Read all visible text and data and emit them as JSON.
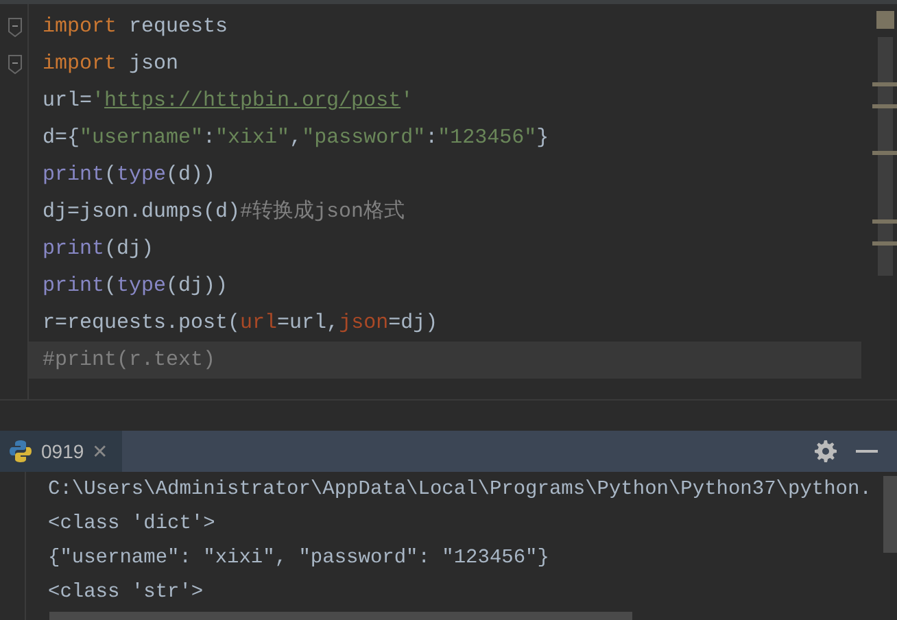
{
  "editor": {
    "lines": [
      {
        "fold": true,
        "current": false,
        "tokens": [
          {
            "kind": "keyword",
            "text": "import"
          },
          {
            "kind": "plain",
            "text": " requests"
          }
        ]
      },
      {
        "fold": true,
        "current": false,
        "tokens": [
          {
            "kind": "keyword",
            "text": "import"
          },
          {
            "kind": "plain",
            "text": " json"
          }
        ]
      },
      {
        "fold": false,
        "current": false,
        "tokens": [
          {
            "kind": "plain",
            "text": "url="
          },
          {
            "kind": "string",
            "text": "'"
          },
          {
            "kind": "link",
            "text": "https://httpbin.org/post"
          },
          {
            "kind": "string",
            "text": "'"
          }
        ]
      },
      {
        "fold": false,
        "current": false,
        "tokens": [
          {
            "kind": "plain",
            "text": "d={"
          },
          {
            "kind": "string",
            "text": "\"username\""
          },
          {
            "kind": "plain",
            "text": ":"
          },
          {
            "kind": "string",
            "text": "\"xixi\""
          },
          {
            "kind": "plain",
            "text": ","
          },
          {
            "kind": "string",
            "text": "\"password\""
          },
          {
            "kind": "plain",
            "text": ":"
          },
          {
            "kind": "string",
            "text": "\"123456\""
          },
          {
            "kind": "plain",
            "text": "}"
          }
        ]
      },
      {
        "fold": false,
        "current": false,
        "tokens": [
          {
            "kind": "builtin",
            "text": "print"
          },
          {
            "kind": "plain",
            "text": "("
          },
          {
            "kind": "builtin",
            "text": "type"
          },
          {
            "kind": "plain",
            "text": "(d))"
          }
        ]
      },
      {
        "fold": false,
        "current": false,
        "tokens": [
          {
            "kind": "plain",
            "text": "dj=json.dumps(d)"
          },
          {
            "kind": "comment",
            "text": "#转换成json格式"
          }
        ]
      },
      {
        "fold": false,
        "current": false,
        "tokens": [
          {
            "kind": "builtin",
            "text": "print"
          },
          {
            "kind": "plain",
            "text": "(dj)"
          }
        ]
      },
      {
        "fold": false,
        "current": false,
        "tokens": [
          {
            "kind": "builtin",
            "text": "print"
          },
          {
            "kind": "plain",
            "text": "("
          },
          {
            "kind": "builtin",
            "text": "type"
          },
          {
            "kind": "plain",
            "text": "(dj))"
          }
        ]
      },
      {
        "fold": false,
        "current": false,
        "tokens": [
          {
            "kind": "plain",
            "text": "r=requests.post("
          },
          {
            "kind": "param",
            "text": "url"
          },
          {
            "kind": "plain",
            "text": "=url,"
          },
          {
            "kind": "param",
            "text": "json"
          },
          {
            "kind": "plain",
            "text": "=dj)"
          }
        ]
      },
      {
        "fold": false,
        "current": true,
        "tokens": [
          {
            "kind": "comment",
            "text": "#print(r.text)"
          }
        ]
      }
    ]
  },
  "run_panel": {
    "tabs": [
      {
        "label": "0919",
        "close": "✕",
        "selected": true
      }
    ],
    "output": [
      "C:\\Users\\Administrator\\AppData\\Local\\Programs\\Python\\Python37\\python.",
      "<class 'dict'>",
      "{\"username\": \"xixi\", \"password\": \"123456\"}",
      "<class 'str'>"
    ]
  }
}
